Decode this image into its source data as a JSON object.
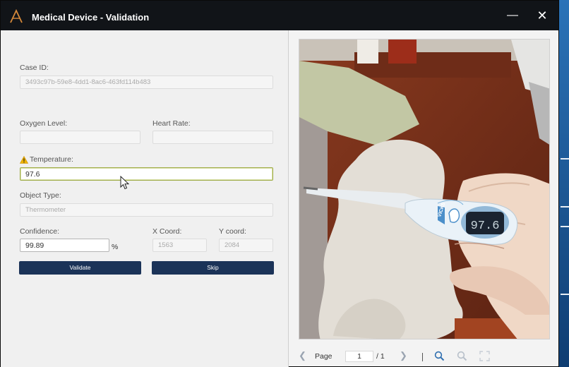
{
  "window": {
    "title": "Medical Device - Validation",
    "minimize_symbol": "—",
    "close_symbol": "✕"
  },
  "form": {
    "case_id": {
      "label": "Case ID:",
      "value": "3493c97b-59e8-4dd1-8ac6-463fd114b483"
    },
    "oxygen_level": {
      "label": "Oxygen Level:",
      "value": ""
    },
    "heart_rate": {
      "label": "Heart Rate:",
      "value": ""
    },
    "temperature": {
      "label": "Temperature:",
      "value": "97.6",
      "warning": true
    },
    "object_type": {
      "label": "Object Type:",
      "value": "Thermometer"
    },
    "confidence": {
      "label": "Confidence:",
      "value": "99.89",
      "unit": "%"
    },
    "x_coord": {
      "label": "X Coord:",
      "value": "1563"
    },
    "y_coord": {
      "label": "Y coord:",
      "value": "2084"
    },
    "validate_label": "Validate",
    "skip_label": "Skip"
  },
  "viewer": {
    "page_label": "Page",
    "current_page": "1",
    "total_pages": "/ 1",
    "prev_icon": "chevron-left-icon",
    "next_icon": "chevron-right-icon",
    "zoom_in_icon": "zoom-in-icon",
    "zoom_out_icon": "zoom-out-icon",
    "fit_icon": "fit-page-icon",
    "thermometer_display": "97.6",
    "thermometer_brand": "VICKS"
  },
  "colors": {
    "titlebar": "#111418",
    "button": "#1b3358",
    "active_field_border": "#a0ad4a",
    "warning": "#f0b400"
  }
}
